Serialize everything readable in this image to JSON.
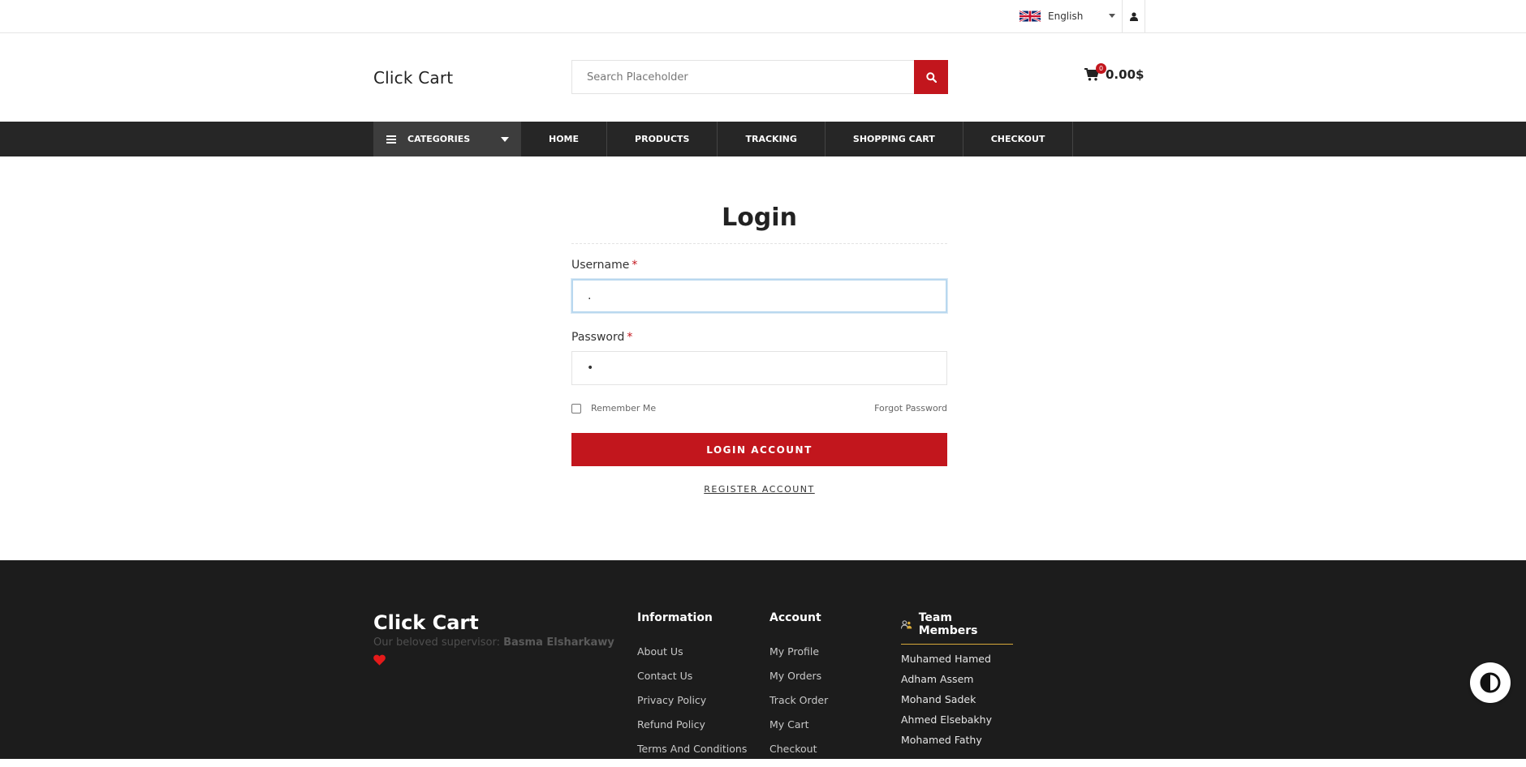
{
  "topbar": {
    "language": "English"
  },
  "header": {
    "logo": "Click Cart",
    "search_placeholder": "Search Placeholder",
    "cart_count": "0",
    "cart_total": "0.00$"
  },
  "nav": {
    "categories_label": "CATEGORIES",
    "items": [
      "HOME",
      "PRODUCTS",
      "TRACKING",
      "SHOPPING CART",
      "CHECKOUT"
    ]
  },
  "login": {
    "title": "Login",
    "username_label": "Username",
    "username_value": ".",
    "password_label": "Password",
    "password_value": "•",
    "required_mark": "*",
    "remember_label": "Remember Me",
    "forgot_label": "Forgot Password",
    "login_button": "LOGIN ACCOUNT",
    "register_link": "REGISTER ACCOUNT"
  },
  "footer": {
    "logo": "Click Cart",
    "supervisor_prefix": "Our beloved supervisor:",
    "supervisor_name": "Basma Elsharkawy",
    "information": {
      "title": "Information",
      "links": [
        "About Us",
        "Contact Us",
        "Privacy Policy",
        "Refund Policy",
        "Terms And Conditions"
      ]
    },
    "account": {
      "title": "Account",
      "links": [
        "My Profile",
        "My Orders",
        "Track Order",
        "My Cart",
        "Checkout"
      ]
    },
    "team": {
      "title": "Team Members",
      "members": [
        "Muhamed Hamed",
        "Adham Assem",
        "Mohand Sadek",
        "Ahmed Elsebakhy",
        "Mohamed Fathy"
      ]
    }
  },
  "colors": {
    "accent": "#c2161d",
    "nav_bg": "#262626",
    "footer_bg": "#1c1c1c",
    "team_underline": "#d7a93a"
  }
}
